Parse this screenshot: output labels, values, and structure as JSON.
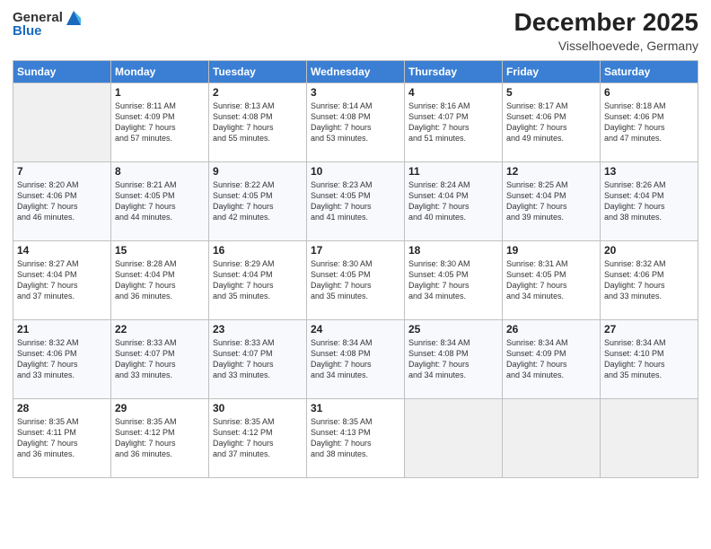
{
  "logo": {
    "general": "General",
    "blue": "Blue"
  },
  "header": {
    "month": "December 2025",
    "location": "Visselhoevede, Germany"
  },
  "days_of_week": [
    "Sunday",
    "Monday",
    "Tuesday",
    "Wednesday",
    "Thursday",
    "Friday",
    "Saturday"
  ],
  "weeks": [
    [
      {
        "day": "",
        "info": ""
      },
      {
        "day": "1",
        "info": "Sunrise: 8:11 AM\nSunset: 4:09 PM\nDaylight: 7 hours\nand 57 minutes."
      },
      {
        "day": "2",
        "info": "Sunrise: 8:13 AM\nSunset: 4:08 PM\nDaylight: 7 hours\nand 55 minutes."
      },
      {
        "day": "3",
        "info": "Sunrise: 8:14 AM\nSunset: 4:08 PM\nDaylight: 7 hours\nand 53 minutes."
      },
      {
        "day": "4",
        "info": "Sunrise: 8:16 AM\nSunset: 4:07 PM\nDaylight: 7 hours\nand 51 minutes."
      },
      {
        "day": "5",
        "info": "Sunrise: 8:17 AM\nSunset: 4:06 PM\nDaylight: 7 hours\nand 49 minutes."
      },
      {
        "day": "6",
        "info": "Sunrise: 8:18 AM\nSunset: 4:06 PM\nDaylight: 7 hours\nand 47 minutes."
      }
    ],
    [
      {
        "day": "7",
        "info": "Sunrise: 8:20 AM\nSunset: 4:06 PM\nDaylight: 7 hours\nand 46 minutes."
      },
      {
        "day": "8",
        "info": "Sunrise: 8:21 AM\nSunset: 4:05 PM\nDaylight: 7 hours\nand 44 minutes."
      },
      {
        "day": "9",
        "info": "Sunrise: 8:22 AM\nSunset: 4:05 PM\nDaylight: 7 hours\nand 42 minutes."
      },
      {
        "day": "10",
        "info": "Sunrise: 8:23 AM\nSunset: 4:05 PM\nDaylight: 7 hours\nand 41 minutes."
      },
      {
        "day": "11",
        "info": "Sunrise: 8:24 AM\nSunset: 4:04 PM\nDaylight: 7 hours\nand 40 minutes."
      },
      {
        "day": "12",
        "info": "Sunrise: 8:25 AM\nSunset: 4:04 PM\nDaylight: 7 hours\nand 39 minutes."
      },
      {
        "day": "13",
        "info": "Sunrise: 8:26 AM\nSunset: 4:04 PM\nDaylight: 7 hours\nand 38 minutes."
      }
    ],
    [
      {
        "day": "14",
        "info": "Sunrise: 8:27 AM\nSunset: 4:04 PM\nDaylight: 7 hours\nand 37 minutes."
      },
      {
        "day": "15",
        "info": "Sunrise: 8:28 AM\nSunset: 4:04 PM\nDaylight: 7 hours\nand 36 minutes."
      },
      {
        "day": "16",
        "info": "Sunrise: 8:29 AM\nSunset: 4:04 PM\nDaylight: 7 hours\nand 35 minutes."
      },
      {
        "day": "17",
        "info": "Sunrise: 8:30 AM\nSunset: 4:05 PM\nDaylight: 7 hours\nand 35 minutes."
      },
      {
        "day": "18",
        "info": "Sunrise: 8:30 AM\nSunset: 4:05 PM\nDaylight: 7 hours\nand 34 minutes."
      },
      {
        "day": "19",
        "info": "Sunrise: 8:31 AM\nSunset: 4:05 PM\nDaylight: 7 hours\nand 34 minutes."
      },
      {
        "day": "20",
        "info": "Sunrise: 8:32 AM\nSunset: 4:06 PM\nDaylight: 7 hours\nand 33 minutes."
      }
    ],
    [
      {
        "day": "21",
        "info": "Sunrise: 8:32 AM\nSunset: 4:06 PM\nDaylight: 7 hours\nand 33 minutes."
      },
      {
        "day": "22",
        "info": "Sunrise: 8:33 AM\nSunset: 4:07 PM\nDaylight: 7 hours\nand 33 minutes."
      },
      {
        "day": "23",
        "info": "Sunrise: 8:33 AM\nSunset: 4:07 PM\nDaylight: 7 hours\nand 33 minutes."
      },
      {
        "day": "24",
        "info": "Sunrise: 8:34 AM\nSunset: 4:08 PM\nDaylight: 7 hours\nand 34 minutes."
      },
      {
        "day": "25",
        "info": "Sunrise: 8:34 AM\nSunset: 4:08 PM\nDaylight: 7 hours\nand 34 minutes."
      },
      {
        "day": "26",
        "info": "Sunrise: 8:34 AM\nSunset: 4:09 PM\nDaylight: 7 hours\nand 34 minutes."
      },
      {
        "day": "27",
        "info": "Sunrise: 8:34 AM\nSunset: 4:10 PM\nDaylight: 7 hours\nand 35 minutes."
      }
    ],
    [
      {
        "day": "28",
        "info": "Sunrise: 8:35 AM\nSunset: 4:11 PM\nDaylight: 7 hours\nand 36 minutes."
      },
      {
        "day": "29",
        "info": "Sunrise: 8:35 AM\nSunset: 4:12 PM\nDaylight: 7 hours\nand 36 minutes."
      },
      {
        "day": "30",
        "info": "Sunrise: 8:35 AM\nSunset: 4:12 PM\nDaylight: 7 hours\nand 37 minutes."
      },
      {
        "day": "31",
        "info": "Sunrise: 8:35 AM\nSunset: 4:13 PM\nDaylight: 7 hours\nand 38 minutes."
      },
      {
        "day": "",
        "info": ""
      },
      {
        "day": "",
        "info": ""
      },
      {
        "day": "",
        "info": ""
      }
    ]
  ]
}
